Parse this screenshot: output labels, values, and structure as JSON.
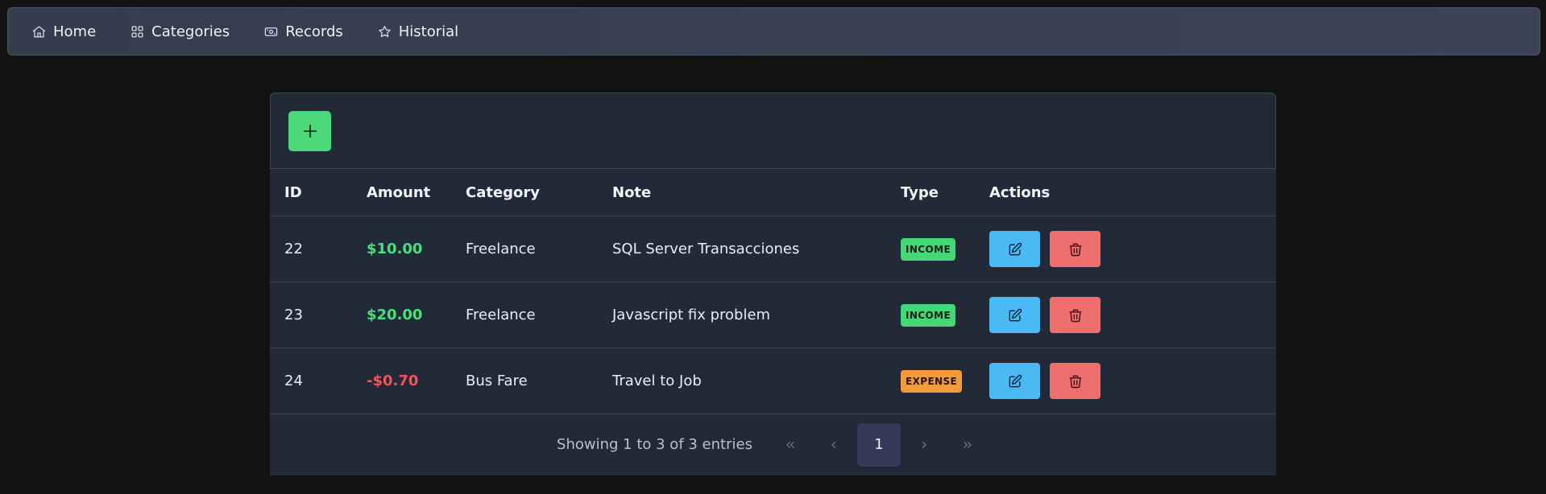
{
  "nav": {
    "items": [
      {
        "label": "Home",
        "icon": "home-icon"
      },
      {
        "label": "Categories",
        "icon": "grid-icon"
      },
      {
        "label": "Records",
        "icon": "money-icon"
      },
      {
        "label": "Historial",
        "icon": "star-icon"
      }
    ]
  },
  "toolbar": {
    "add_icon": "plus-icon"
  },
  "table": {
    "headers": [
      "ID",
      "Amount",
      "Category",
      "Note",
      "Type",
      "Actions"
    ],
    "rows": [
      {
        "id": "22",
        "amount": "$10.00",
        "category": "Freelance",
        "note": "SQL Server Transacciones",
        "type": "INCOME"
      },
      {
        "id": "23",
        "amount": "$20.00",
        "category": "Freelance",
        "note": "Javascript fix problem",
        "type": "INCOME"
      },
      {
        "id": "24",
        "amount": "-$0.70",
        "category": "Bus Fare",
        "note": "Travel to Job",
        "type": "EXPENSE"
      }
    ]
  },
  "pagination": {
    "info": "Showing 1 to 3 of 3 entries",
    "current_page": "1"
  },
  "colors": {
    "background": "#121212",
    "income": "#43d777",
    "expense": "#f39a3a",
    "edit": "#4bb9f3",
    "delete": "#ef6f6f",
    "add": "#4bd97a"
  }
}
